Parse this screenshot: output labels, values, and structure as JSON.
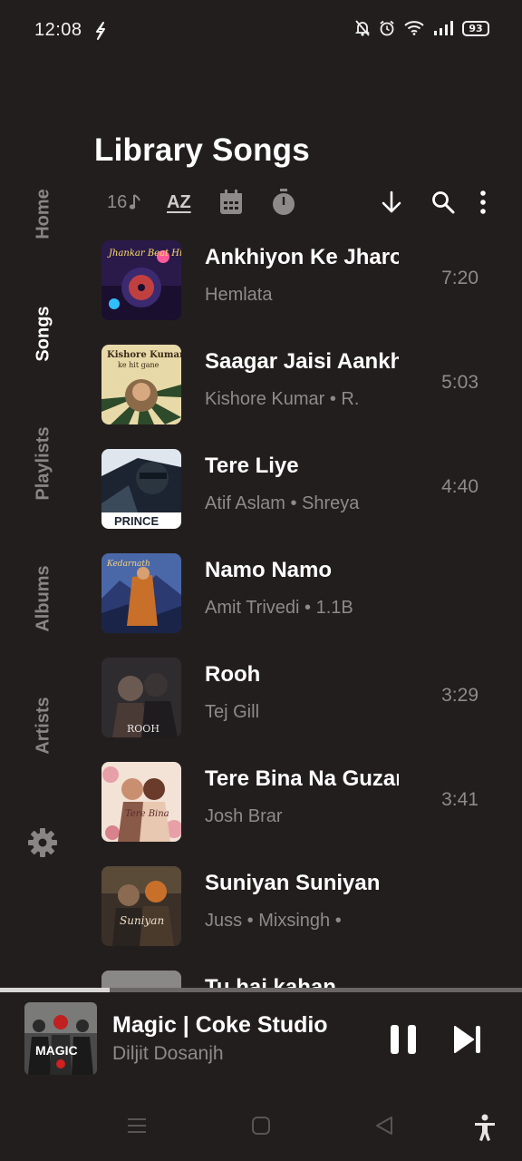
{
  "status": {
    "time": "12:08",
    "battery": "93"
  },
  "header": {
    "title": "Library Songs"
  },
  "toolbar": {
    "count": "16",
    "sort_label": "AZ"
  },
  "sidenav": {
    "items": [
      {
        "label": "Home",
        "active": false
      },
      {
        "label": "Songs",
        "active": true
      },
      {
        "label": "Playlists",
        "active": false
      },
      {
        "label": "Albums",
        "active": false
      },
      {
        "label": "Artists",
        "active": false
      }
    ]
  },
  "songs": [
    {
      "title": "Ankhiyon Ke Jharokhon Se",
      "subtitle": "Hemlata",
      "duration": "7:20",
      "art": "jhankar"
    },
    {
      "title": "Saagar Jaisi Aankhon Wali",
      "subtitle": "Kishore Kumar • R.",
      "duration": "5:03",
      "art": "kishore"
    },
    {
      "title": "Tere Liye",
      "subtitle": "Atif Aslam • Shreya",
      "duration": "4:40",
      "art": "prince"
    },
    {
      "title": "Namo Namo",
      "subtitle": "Amit Trivedi • 1.1B",
      "duration": "",
      "art": "kedarnath"
    },
    {
      "title": "Rooh",
      "subtitle": "Tej Gill",
      "duration": "3:29",
      "art": "rooh"
    },
    {
      "title": "Tere Bina Na Guzara",
      "subtitle": "Josh Brar",
      "duration": "3:41",
      "art": "terebina"
    },
    {
      "title": "Suniyan Suniyan",
      "subtitle": "Juss • Mixsingh •",
      "duration": "",
      "art": "suniyan"
    },
    {
      "title": "Tu hai kahan",
      "subtitle": "",
      "duration": "",
      "art": "tuhai"
    }
  ],
  "art_text": {
    "jhankar": "Jhankar Beat Hits",
    "kishore_line1": "Kishore Kumar",
    "kishore_line2": "ke hit gane",
    "prince": "PRINCE",
    "kedarnath": "Kedarnath",
    "rooh": "ROOH",
    "terebina": "Tere Bina",
    "suniyan": "Suniyan",
    "magic": "MAGIC"
  },
  "player": {
    "title": "Magic | Coke Studio",
    "artist": "Diljit Dosanjh",
    "progress": 0.21
  },
  "colors": {
    "background": "#231e1e",
    "text_primary": "#ffffff",
    "text_secondary": "#8f8a8a"
  }
}
